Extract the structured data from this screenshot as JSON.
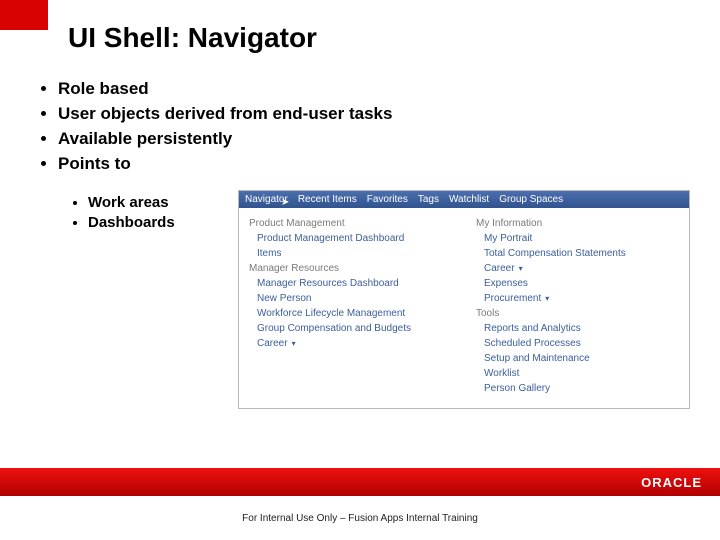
{
  "title": "UI Shell: Navigator",
  "bullets": {
    "b1": "Role based",
    "b2": "User objects derived from end-user tasks",
    "b3": "Available persistently",
    "b4": "Points to"
  },
  "sub_bullets": {
    "s1": "Work areas",
    "s2": "Dashboards"
  },
  "nav_top": {
    "t1": "Navigator",
    "t2": "Recent Items",
    "t3": "Favorites",
    "t4": "Tags",
    "t5": "Watchlist",
    "t6": "Group Spaces"
  },
  "nav_left": {
    "sec1": "Product Management",
    "l1": "Product Management Dashboard",
    "l2": "Items",
    "sec2": "Manager Resources",
    "l3": "Manager Resources Dashboard",
    "l4": "New Person",
    "l5": "Workforce Lifecycle Management",
    "l6": "Group Compensation and Budgets",
    "l7": "Career"
  },
  "nav_right": {
    "sec1": "My Information",
    "r1": "My Portrait",
    "r2": "Total Compensation Statements",
    "r3": "Career",
    "r4": "Expenses",
    "r5": "Procurement",
    "sec2": "Tools",
    "r6": "Reports and Analytics",
    "r7": "Scheduled Processes",
    "r8": "Setup and Maintenance",
    "r9": "Worklist",
    "r10": "Person Gallery"
  },
  "footer": {
    "brand": "ORACLE",
    "note": "For Internal Use Only – Fusion Apps Internal Training"
  }
}
